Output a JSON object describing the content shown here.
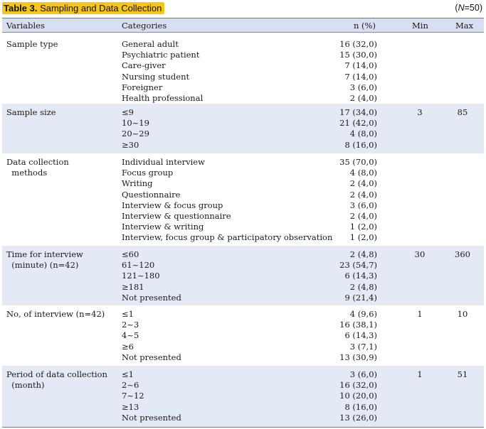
{
  "table": {
    "title_bold": "Table 3.",
    "title_rest": " Sampling and Data Collection",
    "n_note_prefix": "(",
    "n_note_italic": "N",
    "n_note_suffix": "=50)",
    "headers": {
      "variables": "Variables",
      "categories": "Categories",
      "n": "n (%)",
      "min": "Min",
      "max": "Max"
    },
    "groups": [
      {
        "variable": [
          "Sample type"
        ],
        "categories": [
          "General adult",
          "Psychiatric patient",
          "Care-giver",
          "Nursing student",
          "Foreigner",
          "Health professional"
        ],
        "n": [
          "16 (32,0)",
          "15 (30,0)",
          "7 (14,0)",
          "7 (14,0)",
          "3 (6,0)",
          "2 (4,0)"
        ],
        "min": "",
        "max": ""
      },
      {
        "variable": [
          "Sample size"
        ],
        "categories": [
          "≤9",
          "10~19",
          "20~29",
          "≥30"
        ],
        "n": [
          "17 (34,0)",
          "21 (42,0)",
          "4 (8,0)",
          "8 (16,0)"
        ],
        "min": "3",
        "max": "85"
      },
      {
        "variable": [
          "Data collection",
          "  methods"
        ],
        "categories": [
          "Individual interview",
          "Focus group",
          "Writing",
          "Questionnaire",
          "Interview & focus group",
          "Interview & questionnaire",
          "Interview & writing",
          "Interview, focus group & participatory observation"
        ],
        "n": [
          "35 (70,0)",
          "4 (8,0)",
          "2 (4,0)",
          "2 (4,0)",
          "3 (6,0)",
          "2 (4,0)",
          "1 (2,0)",
          "1 (2,0)"
        ],
        "min": "",
        "max": ""
      },
      {
        "variable": [
          "Time for interview",
          "  (minute) (n=42)"
        ],
        "categories": [
          "≤60",
          "61~120",
          "121~180",
          "≥181",
          "Not presented"
        ],
        "n": [
          "2 (4,8)",
          "23 (54,7)",
          "6 (14,3)",
          "2 (4,8)",
          "9 (21,4)"
        ],
        "min": "30",
        "max": "360"
      },
      {
        "variable": [
          "No, of interview (n=42)"
        ],
        "categories": [
          "≤1",
          "2~3",
          "4~5",
          "≥6",
          "Not presented"
        ],
        "n": [
          "4 (9,6)",
          "16 (38,1)",
          "6 (14,3)",
          "3 (7,1)",
          "13 (30,9)"
        ],
        "min": "1",
        "max": "10"
      },
      {
        "variable": [
          "Period of data collection",
          "  (month)"
        ],
        "categories": [
          "≤1",
          "2~6",
          "7~12",
          "≥13",
          "Not presented"
        ],
        "n": [
          "3 (6,0)",
          "16 (32,0)",
          "10 (20,0)",
          "8 (16,0)",
          "13 (26,0)"
        ],
        "min": "1",
        "max": "51"
      }
    ]
  }
}
